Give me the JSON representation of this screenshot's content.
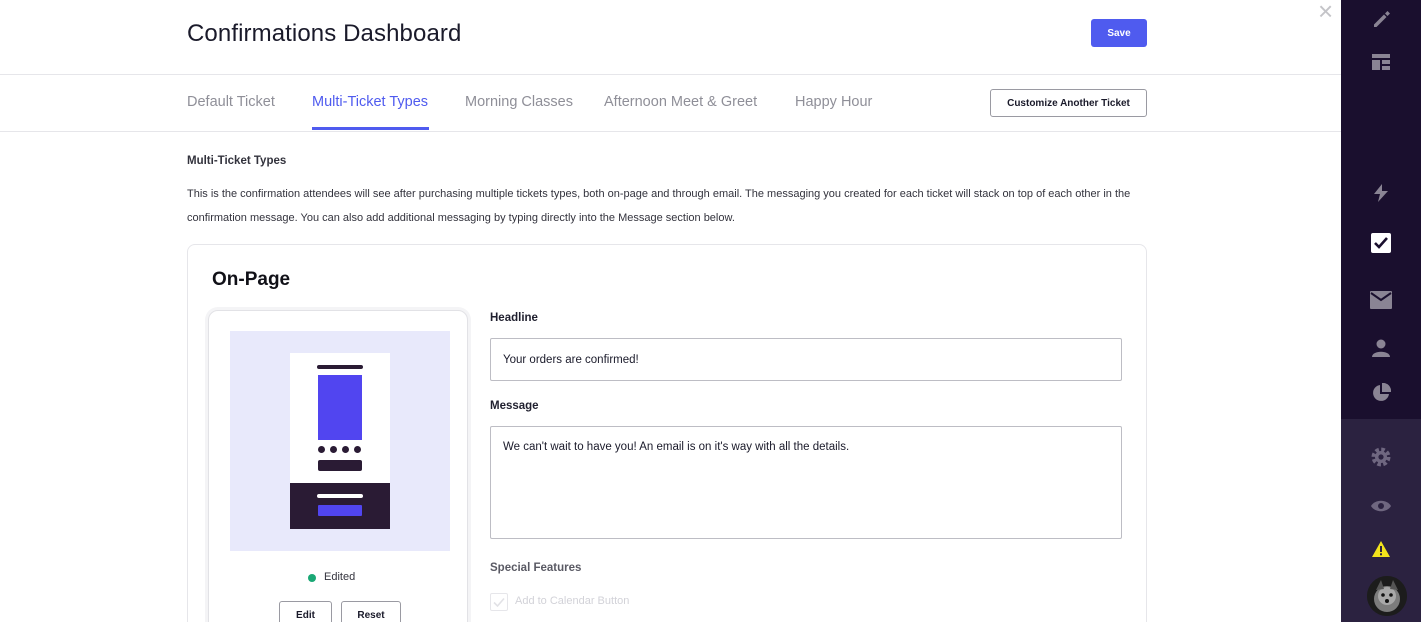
{
  "header": {
    "title": "Confirmations Dashboard",
    "save_label": "Save",
    "close_symbol": "×"
  },
  "tabs": [
    {
      "label": "Default Ticket",
      "active": false
    },
    {
      "label": "Multi-Ticket Types",
      "active": true
    },
    {
      "label": "Morning Classes",
      "active": false
    },
    {
      "label": "Afternoon Meet & Greet",
      "active": false
    },
    {
      "label": "Happy Hour",
      "active": false
    }
  ],
  "customize_label": "Customize Another Ticket",
  "section": {
    "label": "Multi-Ticket Types",
    "description": "This is the confirmation attendees will see after purchasing multiple tickets types, both on-page and through email. The messaging you created for each ticket will stack on top of each other in the confirmation message. You can also add additional messaging by typing directly into the Message section below."
  },
  "card": {
    "title": "On-Page",
    "preview": {
      "status": "Edited",
      "edit_label": "Edit",
      "reset_label": "Reset"
    },
    "headline_label": "Headline",
    "headline_value": "Your orders are confirmed!",
    "message_label": "Message",
    "message_value": "We can't wait to have you! An email is on it's way with all the details.",
    "special_features_label": "Special Features",
    "calendar_checkbox_label": "Add to Calendar Button"
  },
  "sidebar": {
    "icons": [
      "pencil-icon",
      "layout-icon",
      "bolt-icon",
      "checkbox-icon",
      "mail-icon",
      "person-icon",
      "pie-chart-icon",
      "gear-icon",
      "eye-icon",
      "warning-icon"
    ],
    "active_icon": "checkbox-icon"
  },
  "colors": {
    "accent": "#4f5bef",
    "sidebar_bg": "#1a0f2e",
    "sidebar_lower_bg": "#2b2240",
    "status_green": "#1aa875",
    "warning_yellow": "#f2e31c"
  }
}
